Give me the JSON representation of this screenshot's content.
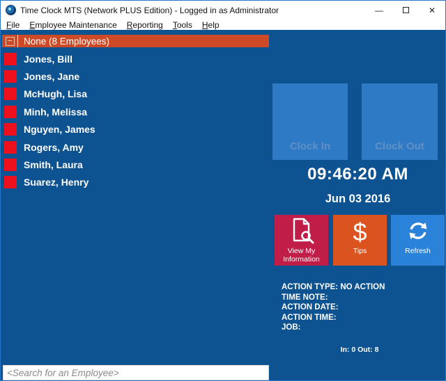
{
  "window": {
    "title": "Time Clock MTS (Network PLUS Edition)  - Logged in as Administrator",
    "controls": {
      "minimize": "—",
      "close": "✕"
    }
  },
  "menu": {
    "items": [
      {
        "key": "F",
        "rest": "ile"
      },
      {
        "key": "E",
        "rest": "mployee Maintenance"
      },
      {
        "key": "R",
        "rest": "eporting"
      },
      {
        "key": "T",
        "rest": "ools"
      },
      {
        "key": "H",
        "rest": "elp"
      }
    ]
  },
  "employee_list": {
    "group_header": "None (8 Employees)",
    "collapse_glyph": "−",
    "employees": [
      "Jones, Bill",
      "Jones, Jane",
      "McHugh, Lisa",
      "Minh, Melissa",
      "Nguyen, James",
      "Rogers, Amy",
      "Smith, Laura",
      "Suarez, Henry"
    ]
  },
  "clock_panel": {
    "clock_in_label": "Clock In",
    "clock_out_label": "Clock Out",
    "time": "09:46:20 AM",
    "date": "Jun 03 2016"
  },
  "action_buttons": {
    "view_info": {
      "label": "View My Information",
      "icon": "document-search-icon",
      "color": "#C01E48"
    },
    "tips": {
      "label": "Tips",
      "icon": "dollar-icon",
      "icon_glyph": "$",
      "color": "#DB5420"
    },
    "refresh": {
      "label": "Refresh",
      "icon": "refresh-icon",
      "color": "#2A83D8"
    }
  },
  "status_panel": {
    "lines": [
      "ACTION TYPE: NO ACTION",
      "TIME NOTE:",
      "ACTION DATE:",
      "ACTION TIME:",
      "JOB:"
    ],
    "in_out_summary": "In: 0 Out: 8"
  },
  "search": {
    "placeholder": "<Search for an Employee>"
  },
  "colors": {
    "background": "#0E5391",
    "group_header": "#CE4A27",
    "employee_square": "#EC111C",
    "clock_button": "#2F7AC4",
    "clock_button_text": "#6190C5"
  }
}
